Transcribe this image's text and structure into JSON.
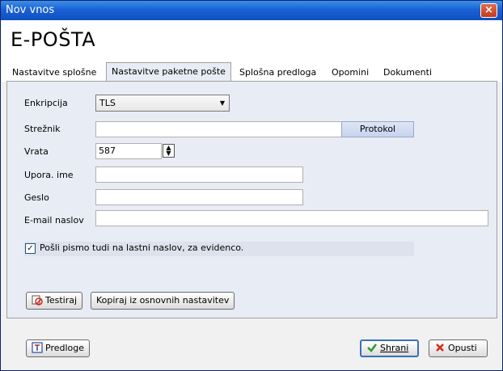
{
  "window": {
    "title": "Nov vnos",
    "close_glyph": "×"
  },
  "header": {
    "title": "E-POŠTA"
  },
  "tabs": [
    {
      "label": "Nastavitve splošne",
      "active": false
    },
    {
      "label": "Nastavitve paketne pošte",
      "active": true
    },
    {
      "label": "Splošna predloga",
      "active": false
    },
    {
      "label": "Opomini",
      "active": false
    },
    {
      "label": "Dokumenti",
      "active": false
    }
  ],
  "form": {
    "encryption": {
      "label": "Enkripcija",
      "value": "TLS"
    },
    "server": {
      "label": "Strežnik",
      "value": "",
      "button": "Protokol"
    },
    "port": {
      "label": "Vrata",
      "value": "587"
    },
    "username": {
      "label": "Upora. ime",
      "value": ""
    },
    "password": {
      "label": "Geslo",
      "value": ""
    },
    "email": {
      "label": "E-mail naslov",
      "value": ""
    },
    "send_copy": {
      "label": "Pošli pismo tudi na lastni naslov, za evidenco.",
      "checked": true
    },
    "test_button": "Testiraj",
    "copy_button": "Kopiraj iz osnovnih nastavitev"
  },
  "footer": {
    "templates_button": "Predloge",
    "save_button": "Shrani",
    "cancel_button": "Opusti"
  },
  "icons": {
    "check_glyph": "✓",
    "dropdown_glyph": "▼",
    "spin_up_glyph": "▲",
    "spin_down_glyph": "▼"
  },
  "colors": {
    "titlebar": "#1a62d4",
    "panel": "#e8ecf4",
    "save_accent": "#2e9a2e",
    "cancel_accent": "#d42a1a"
  }
}
